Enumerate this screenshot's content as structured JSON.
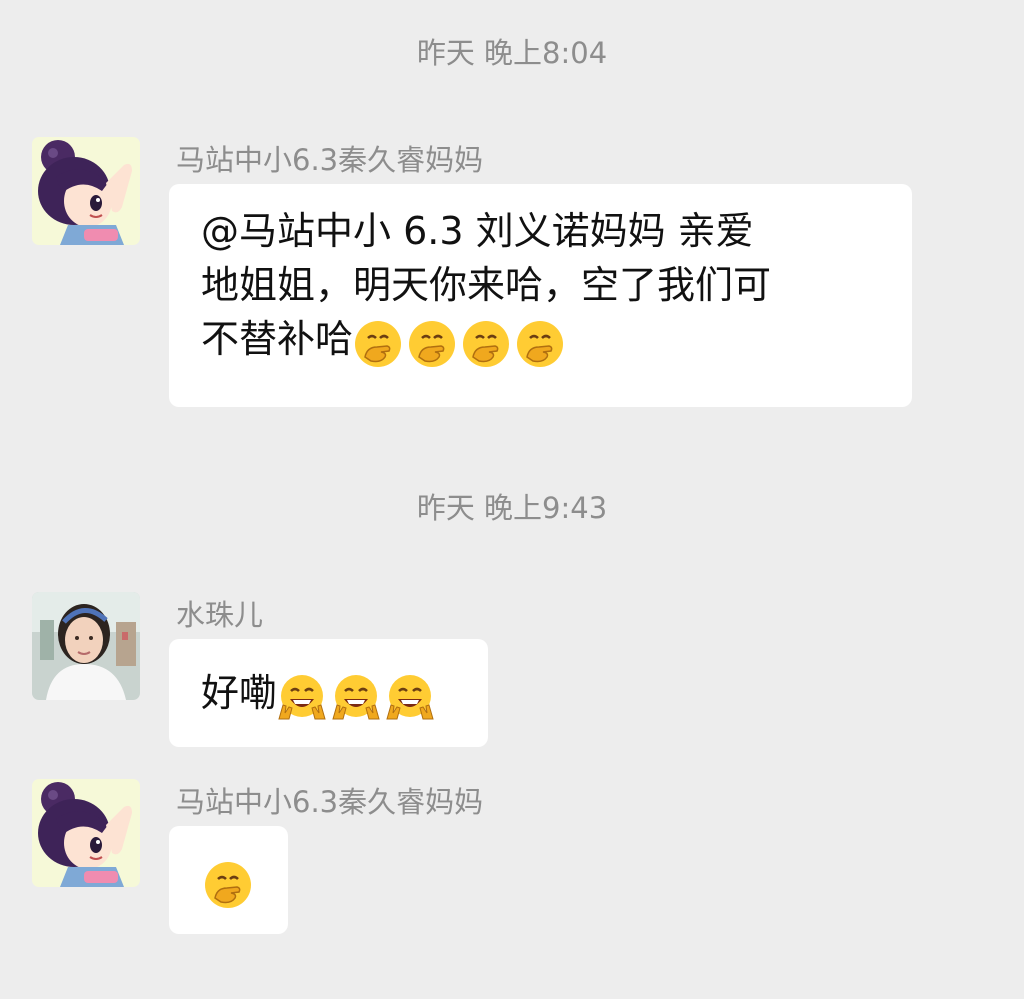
{
  "timestamps": {
    "first": "昨天 晚上8:04",
    "second": "昨天 晚上9:43"
  },
  "messages": [
    {
      "sender": "马站中小6.3秦久睿妈妈",
      "avatar": "cartoon-girl-avatar",
      "lines": [
        "@马站中小 6.3 刘义诺妈妈  亲爱",
        "地姐姐，明天你来哈，空了我们可",
        "不替补哈"
      ],
      "emoji": "hand-over-mouth-emoji",
      "emoji_count": 4
    },
    {
      "sender": "水珠儿",
      "avatar": "photo-woman-avatar",
      "text": "好嘞",
      "emoji": "victory-grin-emoji",
      "emoji_count": 3
    },
    {
      "sender": "马站中小6.3秦久睿妈妈",
      "avatar": "cartoon-girl-avatar",
      "emoji": "hand-over-mouth-emoji",
      "emoji_count": 1
    }
  ],
  "colors": {
    "background": "#ededed",
    "bubble": "#ffffff",
    "meta_text": "#8d8d8d",
    "message_text": "#111111"
  }
}
